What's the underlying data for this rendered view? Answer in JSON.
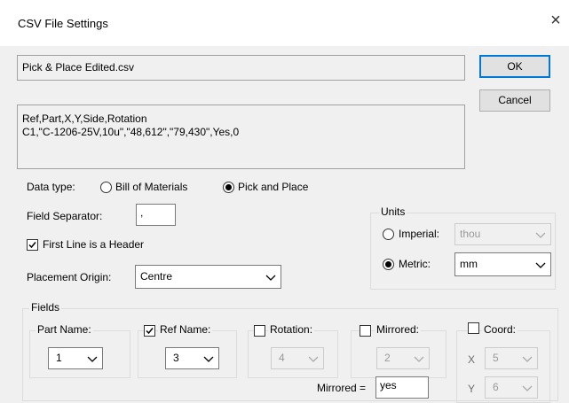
{
  "dialog": {
    "title": "CSV File Settings",
    "close_glyph": "×"
  },
  "file": {
    "name": "Pick & Place Edited.csv",
    "preview_line1": "Ref,Part,X,Y,Side,Rotation",
    "preview_line2": "C1,\"C-1206-25V,10u\",\"48,612\",\"79,430\",Yes,0"
  },
  "buttons": {
    "ok": "OK",
    "cancel": "Cancel"
  },
  "data_type": {
    "label": "Data type:",
    "options": [
      "Bill of Materials",
      "Pick and Place"
    ],
    "selected": "Pick and Place"
  },
  "separator": {
    "label": "Field Separator:",
    "value": ","
  },
  "header_check": {
    "label": "First Line is a Header",
    "checked": true
  },
  "origin": {
    "label": "Placement Origin:",
    "value": "Centre"
  },
  "units": {
    "label": "Units",
    "imperial_label": "Imperial:",
    "imperial_value": "thou",
    "metric_label": "Metric:",
    "metric_value": "mm",
    "selected": "Metric"
  },
  "fields": {
    "label": "Fields",
    "part_name": {
      "label": "Part Name:",
      "value": "1"
    },
    "ref_name": {
      "label": "Ref Name:",
      "value": "3",
      "checked": true
    },
    "rotation": {
      "label": "Rotation:",
      "value": "4",
      "checked": false
    },
    "mirrored": {
      "label": "Mirrored:",
      "value": "2",
      "checked": false
    },
    "mirrored_eq": {
      "label": "Mirrored =",
      "value": "yes"
    },
    "coord": {
      "label": "Coord:",
      "checked": false,
      "x_label": "X",
      "x_value": "5",
      "y_label": "Y",
      "y_value": "6"
    }
  },
  "icons": {
    "chevron": "chevron-down-icon",
    "close": "close-icon"
  }
}
